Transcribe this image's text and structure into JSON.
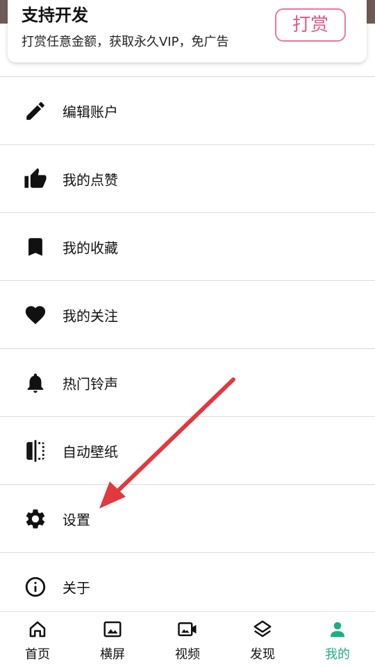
{
  "support": {
    "title": "支持开发",
    "subtitle": "打赏任意金额，获取永久VIP，免广告",
    "reward_label": "打赏"
  },
  "menu": {
    "items": [
      {
        "label": "编辑账户",
        "icon": "pencil-icon"
      },
      {
        "label": "我的点赞",
        "icon": "thumbs-up-icon"
      },
      {
        "label": "我的收藏",
        "icon": "bookmark-icon"
      },
      {
        "label": "我的关注",
        "icon": "heart-icon"
      },
      {
        "label": "热门铃声",
        "icon": "bell-icon"
      },
      {
        "label": "自动壁纸",
        "icon": "wallpaper-flip-icon"
      },
      {
        "label": "设置",
        "icon": "gear-icon"
      },
      {
        "label": "关于",
        "icon": "info-icon"
      }
    ]
  },
  "nav": {
    "items": [
      {
        "label": "首页",
        "icon": "home-icon"
      },
      {
        "label": "横屏",
        "icon": "image-icon"
      },
      {
        "label": "视频",
        "icon": "video-icon"
      },
      {
        "label": "发现",
        "icon": "layers-icon"
      },
      {
        "label": "我的",
        "icon": "person-icon",
        "active": true
      }
    ]
  },
  "colors": {
    "accent": "#1fae84",
    "reward": "#e05a86",
    "arrow": "#e0393e"
  }
}
